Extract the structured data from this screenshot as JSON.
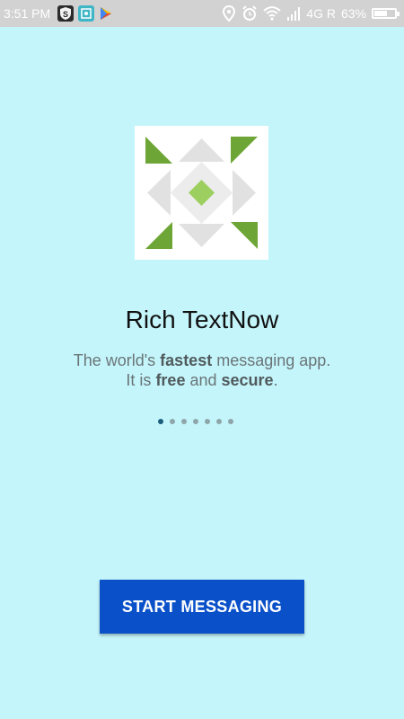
{
  "status_bar": {
    "time": "3:51 PM",
    "network": "4G R",
    "battery_percent_label": "63%",
    "battery_level": 0.63,
    "notification_icons": [
      "shield-s-icon",
      "camera-scan-icon",
      "play-store-icon"
    ],
    "system_icons": [
      "location-icon",
      "alarm-icon",
      "wifi-icon",
      "signal-icon",
      "battery-icon"
    ]
  },
  "onboarding": {
    "logo": "app-logo-icon",
    "title": "Rich TextNow",
    "subtitle_line1_before": "The world's ",
    "subtitle_line1_bold": "fastest",
    "subtitle_line1_after": " messaging app.",
    "subtitle_line2_before": "It is ",
    "subtitle_line2_bold1": "free",
    "subtitle_line2_mid": " and ",
    "subtitle_line2_bold2": "secure",
    "subtitle_line2_after": ".",
    "page_count": 7,
    "active_page": 1
  },
  "actions": {
    "start_label": "START MESSAGING"
  },
  "colors": {
    "background": "#c4f5fb",
    "button": "#0a51c9",
    "status_bar": "#d2d2d2",
    "logo_green": "#6da636",
    "logo_gray": "#e1e1e1"
  }
}
